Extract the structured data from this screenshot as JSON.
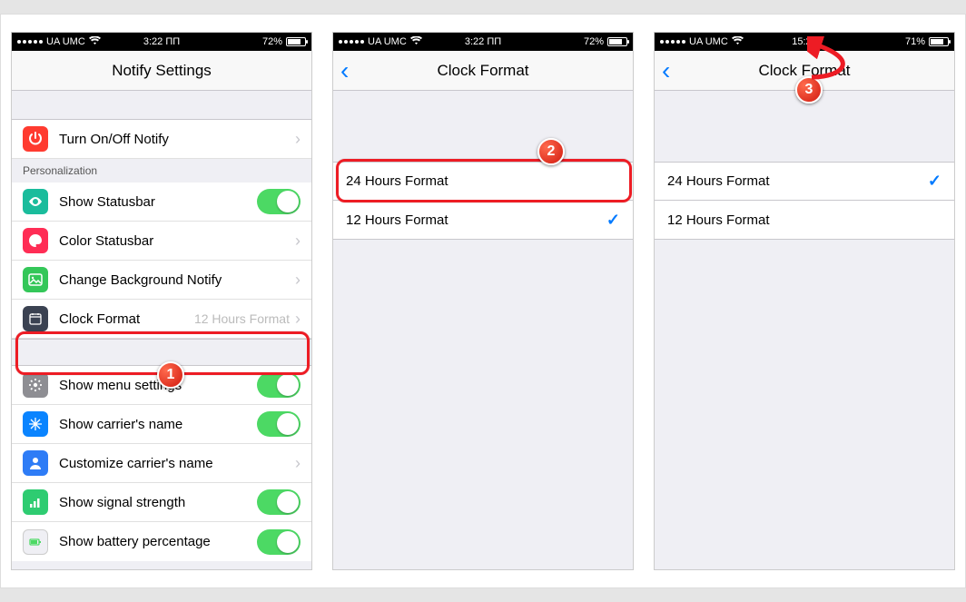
{
  "status": {
    "carrier": "UA UMC",
    "battery": "72%",
    "battery3": "71%",
    "time12": "3:22 ПП",
    "time24": "15:22"
  },
  "s1": {
    "title": "Notify Settings",
    "notify_row": "Turn On/Off Notify",
    "section": "Personalization",
    "rows": {
      "statusbar": "Show Statusbar",
      "color": "Color Statusbar",
      "bg": "Change Background Notify",
      "clock": "Clock Format",
      "clock_detail": "12 Hours Format",
      "menu": "Show menu settings",
      "carrier": "Show carrier's name",
      "custom_carrier": "Customize carrier's name",
      "signal": "Show signal strength",
      "battery_row": "Show battery percentage"
    }
  },
  "s2": {
    "title": "Clock Format",
    "opt24": "24 Hours Format",
    "opt12": "12 Hours Format"
  },
  "s3": {
    "title": "Clock Format",
    "opt24": "24 Hours Format",
    "opt12": "12 Hours Format"
  },
  "badges": {
    "b1": "1",
    "b2": "2",
    "b3": "3"
  }
}
